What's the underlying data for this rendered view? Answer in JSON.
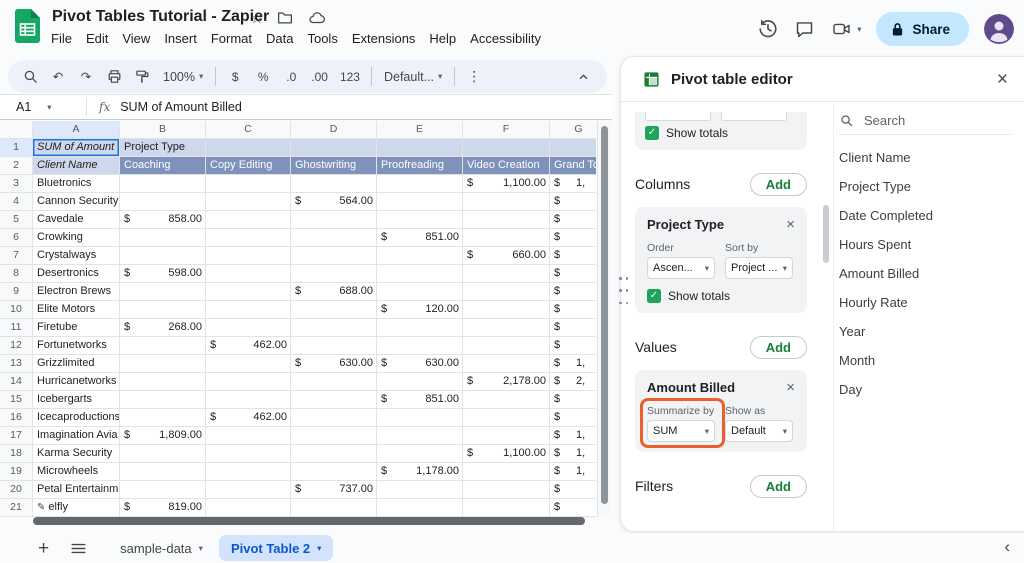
{
  "colors": {
    "sheets_green": "#16a765",
    "pivot_header_dark": "#7e92bc",
    "pivot_header_light": "#cdd8ec",
    "checkbox_green": "#1ea55b",
    "add_button_green": "#188038",
    "highlight_orange": "#e8612c",
    "active_tab_blue": "#0b57d0",
    "active_tab_bg": "#d3e3fd",
    "share_bg": "#c2e7ff"
  },
  "titlebar": {
    "title": "Pivot Tables Tutorial - Zapier",
    "menus": [
      "File",
      "Edit",
      "View",
      "Insert",
      "Format",
      "Data",
      "Tools",
      "Extensions",
      "Help",
      "Accessibility"
    ],
    "share_label": "Share"
  },
  "toolbar": {
    "zoom_value": "100%",
    "currency_label": "$",
    "percent_label": "%",
    "decrease_decimal_label": ".0",
    "increase_decimal_label": ".00",
    "more_formats_label": "123",
    "font_value": "Default..."
  },
  "formula_bar": {
    "cell_ref": "A1",
    "fx_label": "fx",
    "value": "SUM of  Amount Billed"
  },
  "grid": {
    "col_letters": [
      "A",
      "B",
      "C",
      "D",
      "E",
      "F",
      "G"
    ],
    "pivot_title": "SUM of  Amount",
    "pivot_col_group": "Project Type",
    "pivot_row_label": "Client Name",
    "col_headers": [
      "Coaching",
      "Copy Editing",
      "Ghostwriting",
      "Proofreading",
      "Video Creation",
      "Grand Total"
    ],
    "currency_symbol": "$",
    "rows": [
      {
        "name": "Bluetronics",
        "values": [
          "",
          "",
          "",
          "",
          "1,100.00"
        ],
        "total_partial": "1,"
      },
      {
        "name": "Cannon Security",
        "values": [
          "",
          "",
          "564.00",
          "",
          ""
        ],
        "total_partial": ""
      },
      {
        "name": "Cavedale",
        "values": [
          "858.00",
          "",
          "",
          "",
          ""
        ],
        "total_partial": ""
      },
      {
        "name": "Crowking",
        "values": [
          "",
          "",
          "",
          "851.00",
          ""
        ],
        "total_partial": ""
      },
      {
        "name": "Crystalways",
        "values": [
          "",
          "",
          "",
          "",
          "660.00"
        ],
        "total_partial": ""
      },
      {
        "name": "Desertronics",
        "values": [
          "598.00",
          "",
          "",
          "",
          ""
        ],
        "total_partial": ""
      },
      {
        "name": "Electron Brews",
        "values": [
          "",
          "",
          "688.00",
          "",
          ""
        ],
        "total_partial": ""
      },
      {
        "name": "Elite Motors",
        "values": [
          "",
          "",
          "",
          "120.00",
          ""
        ],
        "total_partial": ""
      },
      {
        "name": "Firetube",
        "values": [
          "268.00",
          "",
          "",
          "",
          ""
        ],
        "total_partial": ""
      },
      {
        "name": "Fortunetworks",
        "values": [
          "",
          "462.00",
          "",
          "",
          ""
        ],
        "total_partial": ""
      },
      {
        "name": "Grizzlimited",
        "values": [
          "",
          "",
          "630.00",
          "630.00",
          ""
        ],
        "total_partial": "1,"
      },
      {
        "name": "Hurricanetworks",
        "values": [
          "",
          "",
          "",
          "",
          "2,178.00"
        ],
        "total_partial": "2,"
      },
      {
        "name": "Icebergarts",
        "values": [
          "",
          "",
          "",
          "851.00",
          ""
        ],
        "total_partial": ""
      },
      {
        "name": "Icecaproductions",
        "values": [
          "",
          "462.00",
          "",
          "",
          ""
        ],
        "total_partial": ""
      },
      {
        "name": "Imagination Avia",
        "values": [
          "1,809.00",
          "",
          "",
          "",
          ""
        ],
        "total_partial": "1,"
      },
      {
        "name": "Karma Security",
        "values": [
          "",
          "",
          "",
          "",
          "1,100.00"
        ],
        "total_partial": "1,"
      },
      {
        "name": "Microwheels",
        "values": [
          "",
          "",
          "",
          "1,178.00",
          ""
        ],
        "total_partial": "1,"
      },
      {
        "name": "Petal Entertainment",
        "values": [
          "",
          "",
          "737.00",
          "",
          ""
        ],
        "total_partial": ""
      },
      {
        "name": "elfly",
        "values": [
          "819.00",
          "",
          "",
          "",
          ""
        ],
        "total_partial": "",
        "editing": true
      }
    ]
  },
  "panel": {
    "title": "Pivot table editor",
    "search_placeholder": "Search",
    "rows_section": {
      "show_totals_label": "Show totals"
    },
    "columns_section": {
      "label": "Columns",
      "add_label": "Add",
      "card_title": "Project Type",
      "order_label": "Order",
      "sort_label": "Sort by",
      "order_value": "Ascen...",
      "sort_value": "Project ...",
      "show_totals_label": "Show totals"
    },
    "values_section": {
      "label": "Values",
      "add_label": "Add",
      "card_title": "Amount Billed",
      "summarize_label": "Summarize by",
      "show_as_label": "Show as",
      "summarize_value": "SUM",
      "show_as_value": "Default"
    },
    "filters_section": {
      "label": "Filters",
      "add_label": "Add"
    },
    "fields": [
      "Client Name",
      "Project Type",
      "Date Completed",
      "Hours Spent",
      "Amount Billed",
      "Hourly Rate",
      "Year",
      "Month",
      "Day"
    ]
  },
  "sheet_tabs": {
    "tab1": "sample-data",
    "tab2": "Pivot Table 2"
  }
}
